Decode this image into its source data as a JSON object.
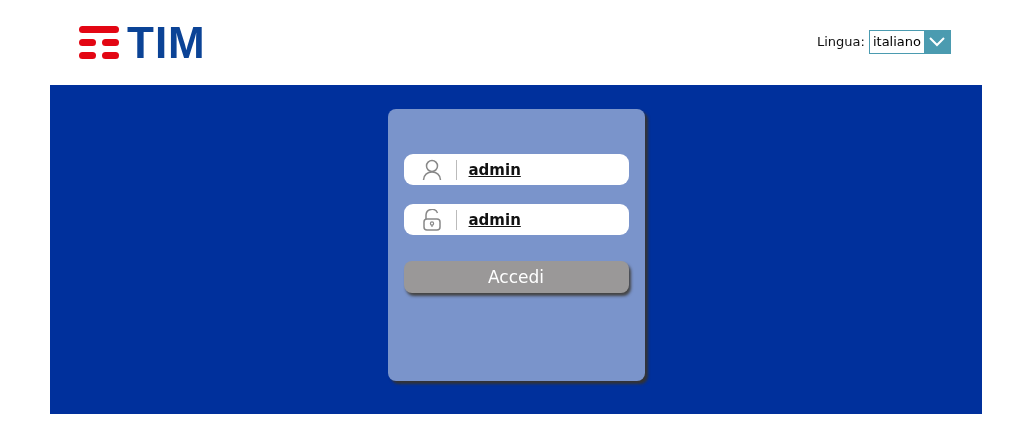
{
  "header": {
    "logo_text": "TIM",
    "language_label": "Lingua:",
    "language_value": "italiano"
  },
  "login": {
    "username": {
      "value": "admin"
    },
    "password": {
      "value": "admin"
    },
    "submit": "Accedi"
  }
}
